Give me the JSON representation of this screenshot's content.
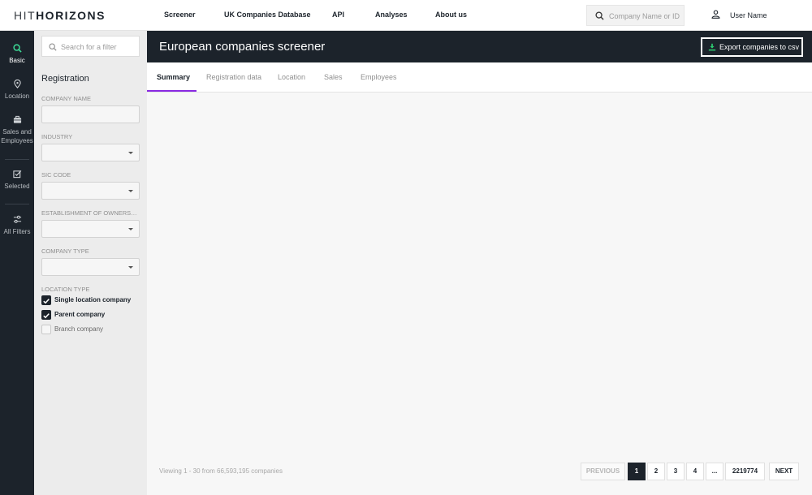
{
  "logo": {
    "light": "HIT",
    "bold": "HORIZONS"
  },
  "nav": [
    "Screener",
    "UK Companies Database",
    "API",
    "Analyses",
    "About us"
  ],
  "search": {
    "placeholder": "Company Name or ID",
    "icon": "search-icon"
  },
  "user": {
    "name": "User Name",
    "icon": "user-icon"
  },
  "rail": [
    {
      "label": "Basic",
      "icon": "search-icon",
      "active": true
    },
    {
      "label": "Location",
      "icon": "location-pin-icon",
      "active": false
    },
    {
      "label": "Sales and Employees",
      "icon": "briefcase-icon",
      "active": false
    },
    {
      "label": "Selected",
      "icon": "checkbox-edit-icon",
      "active": false
    },
    {
      "label": "All Filters",
      "icon": "sliders-icon",
      "active": false
    }
  ],
  "filters": {
    "search_placeholder": "Search for a filter",
    "section_title": "Registration",
    "fields": {
      "company_name": "COMPANY NAME",
      "industry": "INDUSTRY",
      "sic_code": "SIC CODE",
      "ownership": "ESTABLISHMENT OF OWNERSHIP",
      "company_type": "COMPANY TYPE",
      "location_type": "LOCATION TYPE"
    },
    "location_types": [
      {
        "label": "Single location company",
        "checked": true
      },
      {
        "label": "Parent company",
        "checked": true
      },
      {
        "label": "Branch company",
        "checked": false
      }
    ]
  },
  "main": {
    "title": "European companies screener",
    "export_label": "Export companies to csv",
    "tabs": [
      "Summary",
      "Registration data",
      "Location",
      "Sales",
      "Employees"
    ],
    "active_tab": "Summary",
    "status": "Viewing 1 - 30 from 66,593,195 companies"
  },
  "pagination": {
    "previous": "PREVIOUS",
    "pages": [
      "1",
      "2",
      "3",
      "4",
      "...",
      "2219774"
    ],
    "current": "1",
    "next": "NEXT"
  },
  "colors": {
    "dark": "#1c232b",
    "accent_tab": "#8a2be2",
    "export_icon": "#2ecc71",
    "rail_active_icon": "#3ddc97"
  }
}
